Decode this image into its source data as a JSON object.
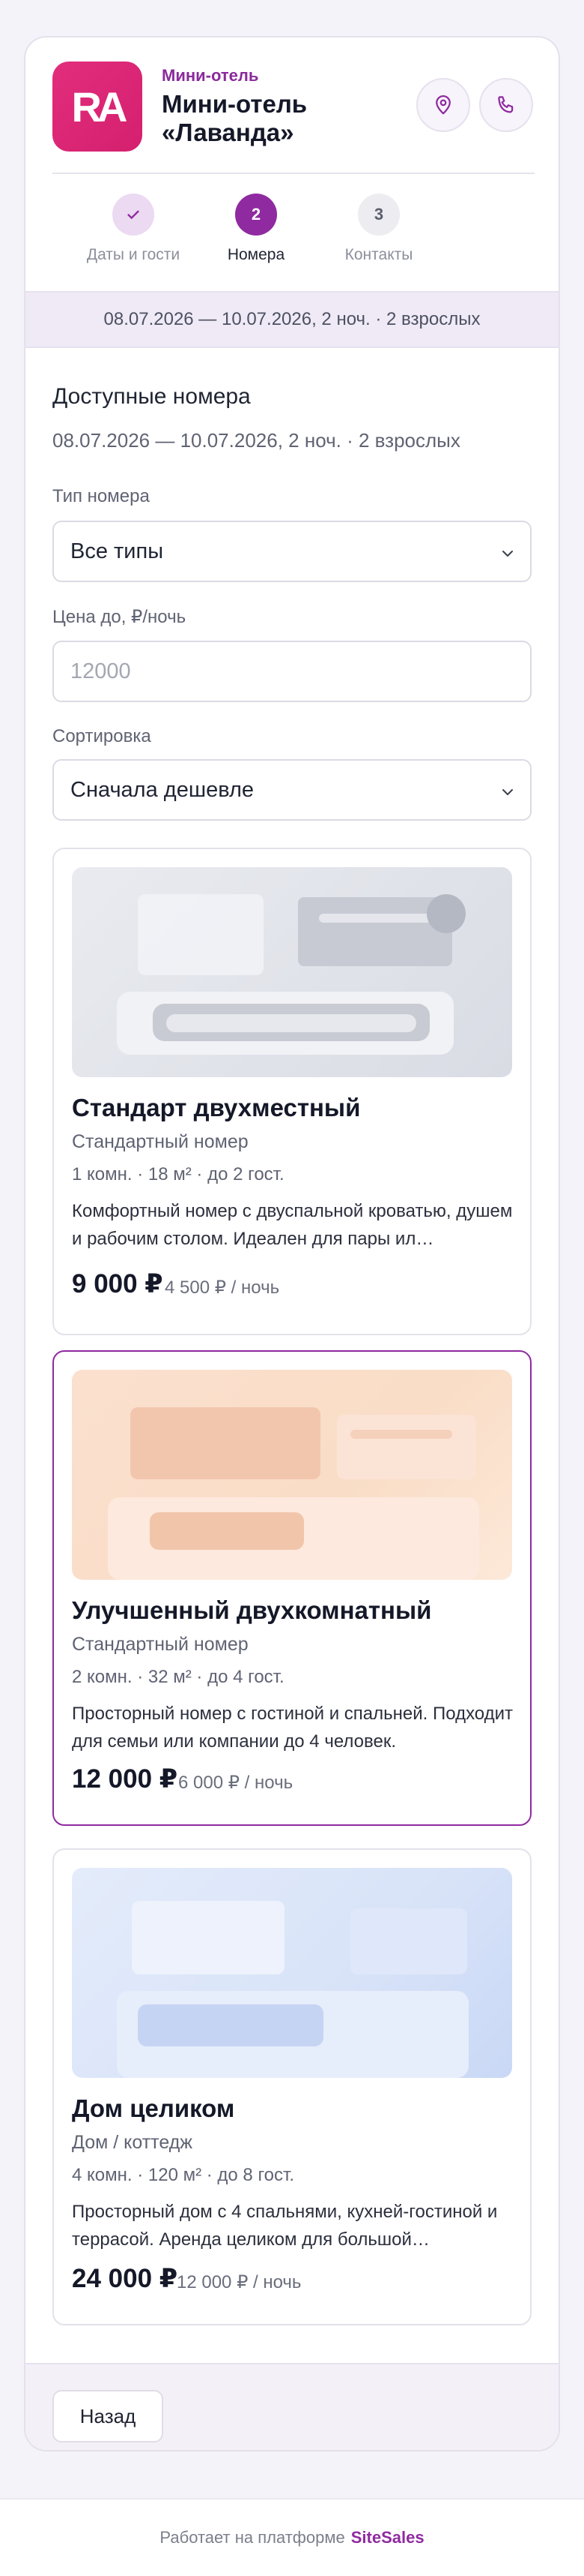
{
  "header": {
    "logo_text": "RA",
    "eyebrow": "Мини-отель",
    "hotel_name": "Мини-отель «Лаванда»",
    "icons": [
      "map-pin-icon",
      "phone-icon"
    ]
  },
  "steps": [
    {
      "num": "✓",
      "label": "Даты и гости",
      "state": "done"
    },
    {
      "num": "2",
      "label": "Номера",
      "state": "active"
    },
    {
      "num": "3",
      "label": "Контакты",
      "state": "todo"
    }
  ],
  "summary": "08.07.2026 — 10.07.2026, 2 ноч. · 2 взрослых",
  "section": {
    "title": "Доступные номера",
    "subtitle": "08.07.2026 — 10.07.2026, 2 ноч. · 2 взрослых"
  },
  "filters": {
    "type_label": "Тип номера",
    "type_value": "Все типы",
    "price_label": "Цена до, ₽/ночь",
    "price_placeholder": "12000",
    "sort_label": "Сортировка",
    "sort_value": "Сначала дешевле"
  },
  "rooms": [
    {
      "name": "Стандарт двухместный",
      "type": "Стандартный номер",
      "specs": "1 комн. · 18 м² · до 2 гост.",
      "desc": "Комфортный номер с двуспальной кроватью, душем и рабочим столом. Идеален для пары ил…",
      "price": "9 000 ₽",
      "per_night": "4 500 ₽ / ночь",
      "selected": false,
      "palette": "gray"
    },
    {
      "name": "Улучшенный двухкомнатный",
      "type": "Стандартный номер",
      "specs": "2 комн. · 32 м² · до 4 гост.",
      "desc": "Просторный номер с гостиной и спальней. Подходит для семьи или компании до 4 человек.",
      "price": "12 000 ₽",
      "per_night": "6 000 ₽ / ночь",
      "selected": true,
      "palette": "peach"
    },
    {
      "name": "Дом целиком",
      "type": "Дом / коттедж",
      "specs": "4 комн. · 120 м² · до 8 гост.",
      "desc": "Просторный дом с 4 спальнями, кухней-гостиной и террасой. Аренда целиком для большой…",
      "price": "24 000 ₽",
      "per_night": "12 000 ₽ / ночь",
      "selected": false,
      "palette": "blue"
    }
  ],
  "buttons": {
    "back": "Назад"
  },
  "footer": {
    "powered_text": "Работает на платформе",
    "brand": "SiteSales"
  },
  "colors": {
    "accent": "#8f2aa0",
    "logo": "#e22d7d",
    "summary_bg": "#efeaf6"
  }
}
